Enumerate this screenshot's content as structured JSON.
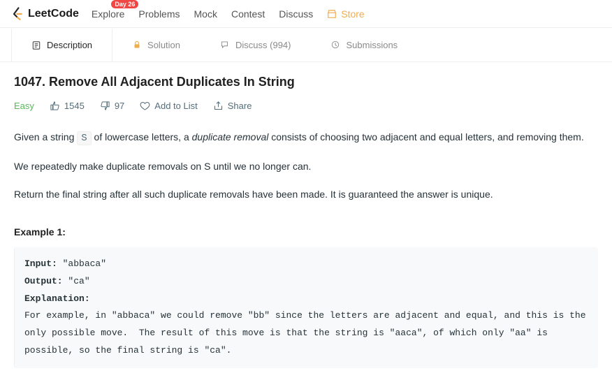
{
  "nav": {
    "logo": "LeetCode",
    "explore": "Explore",
    "explore_badge": "Day 26",
    "problems": "Problems",
    "mock": "Mock",
    "contest": "Contest",
    "discuss": "Discuss",
    "store": "Store"
  },
  "tabs": {
    "description": "Description",
    "solution": "Solution",
    "discuss": "Discuss (994)",
    "submissions": "Submissions"
  },
  "problem": {
    "title": "1047. Remove All Adjacent Duplicates In String",
    "difficulty": "Easy",
    "likes": "1545",
    "dislikes": "97",
    "add_to_list": "Add to List",
    "share": "Share"
  },
  "desc": {
    "p1a": "Given a string ",
    "p1_code": "S",
    "p1b": " of lowercase letters, a ",
    "p1_em": "duplicate removal",
    "p1c": " consists of choosing two adjacent and equal letters, and removing them.",
    "p2": "We repeatedly make duplicate removals on S until we no longer can.",
    "p3": "Return the final string after all such duplicate removals have been made.  It is guaranteed the answer is unique."
  },
  "example": {
    "label": "Example 1:",
    "input_label": "Input: ",
    "input_val": "\"abbaca\"",
    "output_label": "Output: ",
    "output_val": "\"ca\"",
    "explanation_label": "Explanation: ",
    "explanation_text": "For example, in \"abbaca\" we could remove \"bb\" since the letters are adjacent and equal, and this is the only possible move.  The result of this move is that the string is \"aaca\", of which only \"aa\" is possible, so the final string is \"ca\"."
  }
}
